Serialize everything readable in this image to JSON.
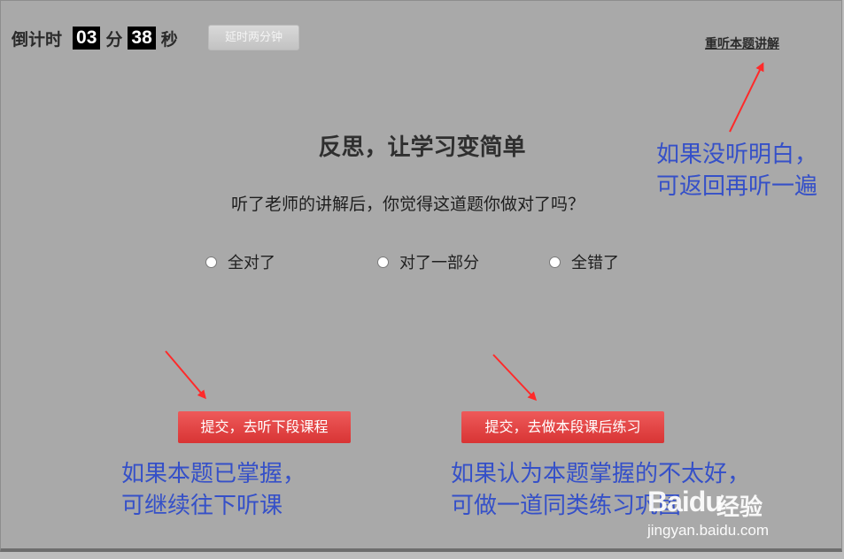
{
  "timer": {
    "label": "倒计时",
    "minutes": "03",
    "minutes_unit": "分",
    "seconds": "38",
    "seconds_unit": "秒",
    "extend_button": "延时两分钟"
  },
  "relisten_link": "重听本题讲解",
  "title": "反思，让学习变简单",
  "question": "听了老师的讲解后，你觉得这道题你做对了吗？",
  "options": [
    {
      "label": "全对了"
    },
    {
      "label": "对了一部分"
    },
    {
      "label": "全错了"
    }
  ],
  "buttons": {
    "next_lesson": "提交，去听下段课程",
    "practice": "提交，去做本段课后练习"
  },
  "annotations": {
    "relisten_line1": "如果没听明白，",
    "relisten_line2": "可返回再听一遍",
    "next_line1": "如果本题已掌握，",
    "next_line2": "可继续往下听课",
    "practice_line1": "如果认为本题掌握的不太好，",
    "practice_line2": "可做一道同类练习巩固"
  },
  "watermark": {
    "brand": "Baidu",
    "suffix": "经验",
    "url": "jingyan.baidu.com"
  },
  "colors": {
    "annotation": "#3550c8",
    "arrow": "#ff2a2a",
    "button": "#e04444"
  }
}
